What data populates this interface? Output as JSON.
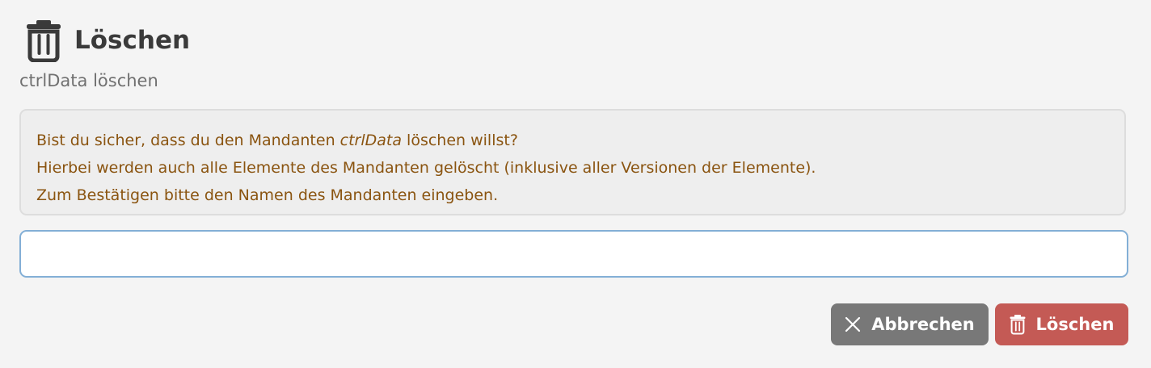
{
  "header": {
    "icon": "trash-icon",
    "title": "Löschen",
    "subtitle": "ctrlData löschen"
  },
  "message": {
    "line1_before": "Bist du sicher, dass du den Mandanten ",
    "line1_name": "ctrlData",
    "line1_after": " löschen willst?",
    "line2": "Hierbei werden auch alle Elemente des Mandanten gelöscht (inklusive aller Versionen der Elemente).",
    "line3": "Zum Bestätigen bitte den Namen des Mandanten eingeben."
  },
  "confirm_input": {
    "value": "",
    "placeholder": ""
  },
  "buttons": {
    "cancel_label": "Abbrechen",
    "cancel_icon": "close-icon",
    "delete_label": "Löschen",
    "delete_icon": "trash-icon"
  },
  "colors": {
    "background": "#f4f4f4",
    "message_text": "#8a5410",
    "cancel_button": "#787878",
    "delete_button": "#c45a55",
    "input_border": "#83afd6"
  }
}
